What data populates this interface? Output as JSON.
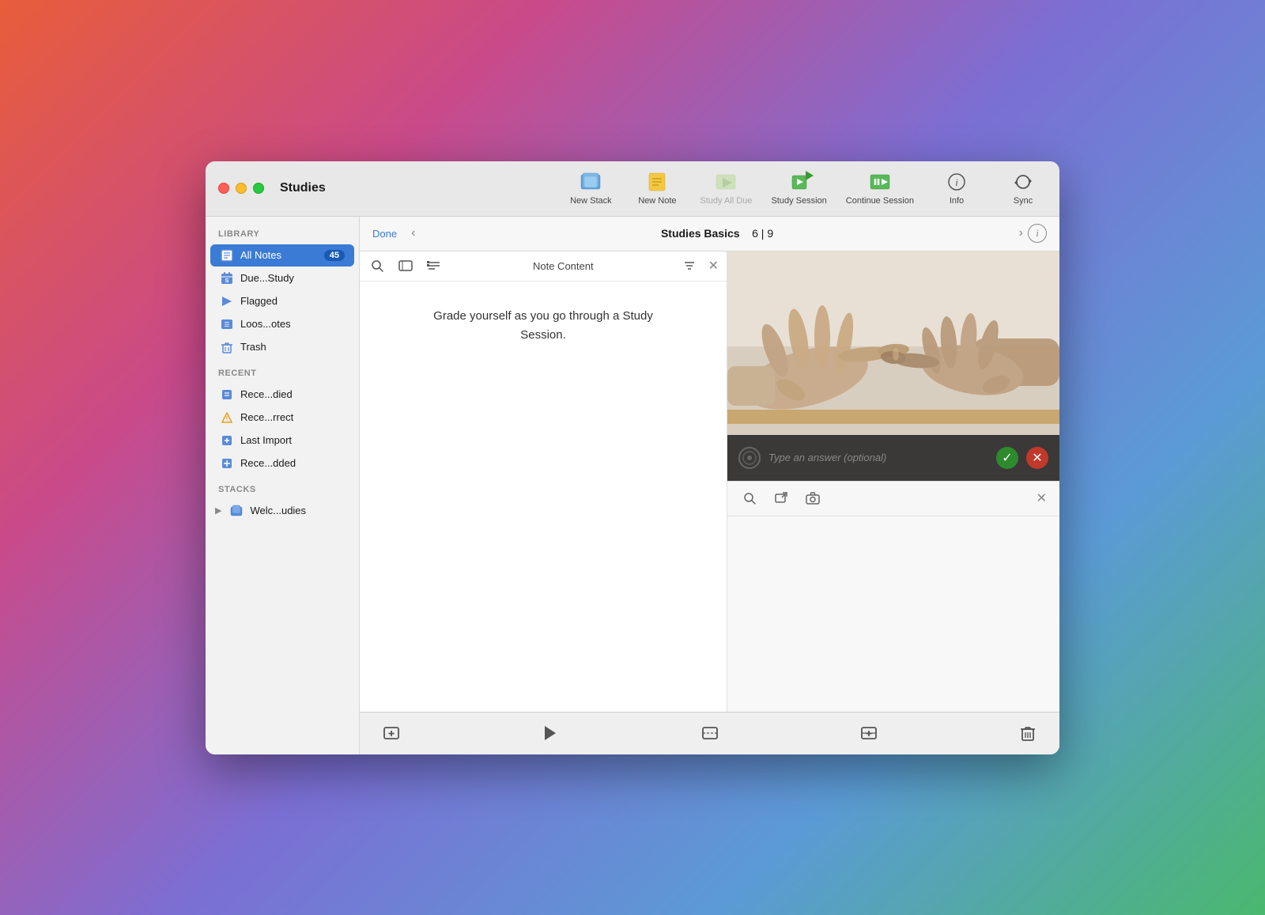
{
  "window": {
    "title": "Studies"
  },
  "toolbar": {
    "new_stack_label": "New Stack",
    "new_note_label": "New Note",
    "study_all_due_label": "Study All Due",
    "study_session_label": "Study Session",
    "continue_session_label": "Continue Session",
    "info_label": "Info",
    "sync_label": "Sync"
  },
  "sidebar": {
    "library_label": "LIBRARY",
    "recent_label": "RECENT",
    "stacks_label": "STACKS",
    "items": [
      {
        "id": "all-notes",
        "label": "All Notes",
        "badge": "45",
        "active": true
      },
      {
        "id": "due-study",
        "label": "Due...Study",
        "badge": "",
        "active": false
      },
      {
        "id": "flagged",
        "label": "Flagged",
        "badge": "",
        "active": false
      },
      {
        "id": "loos-otes",
        "label": "Loos...otes",
        "badge": "",
        "active": false
      },
      {
        "id": "trash",
        "label": "Trash",
        "badge": "",
        "active": false
      }
    ],
    "recent_items": [
      {
        "id": "rece-died",
        "label": "Rece...died"
      },
      {
        "id": "rece-rrect",
        "label": "Rece...rrect"
      },
      {
        "id": "last-import",
        "label": "Last Import"
      },
      {
        "id": "rece-dded",
        "label": "Rece...dded"
      }
    ],
    "stack_items": [
      {
        "id": "welc-udies",
        "label": "Welc...udies"
      }
    ]
  },
  "nav": {
    "done_label": "Done",
    "title": "Studies Basics",
    "progress": "6 | 9"
  },
  "note_panel": {
    "content_label": "Note Content",
    "text": "Grade yourself as you go through a Study Session."
  },
  "answer_panel": {
    "input_placeholder": "Type an answer (optional)"
  },
  "colors": {
    "accent": "#3a7bd5",
    "active_badge": "#1a5ab5",
    "correct_green": "#2d8a2d",
    "incorrect_red": "#c0392b"
  }
}
